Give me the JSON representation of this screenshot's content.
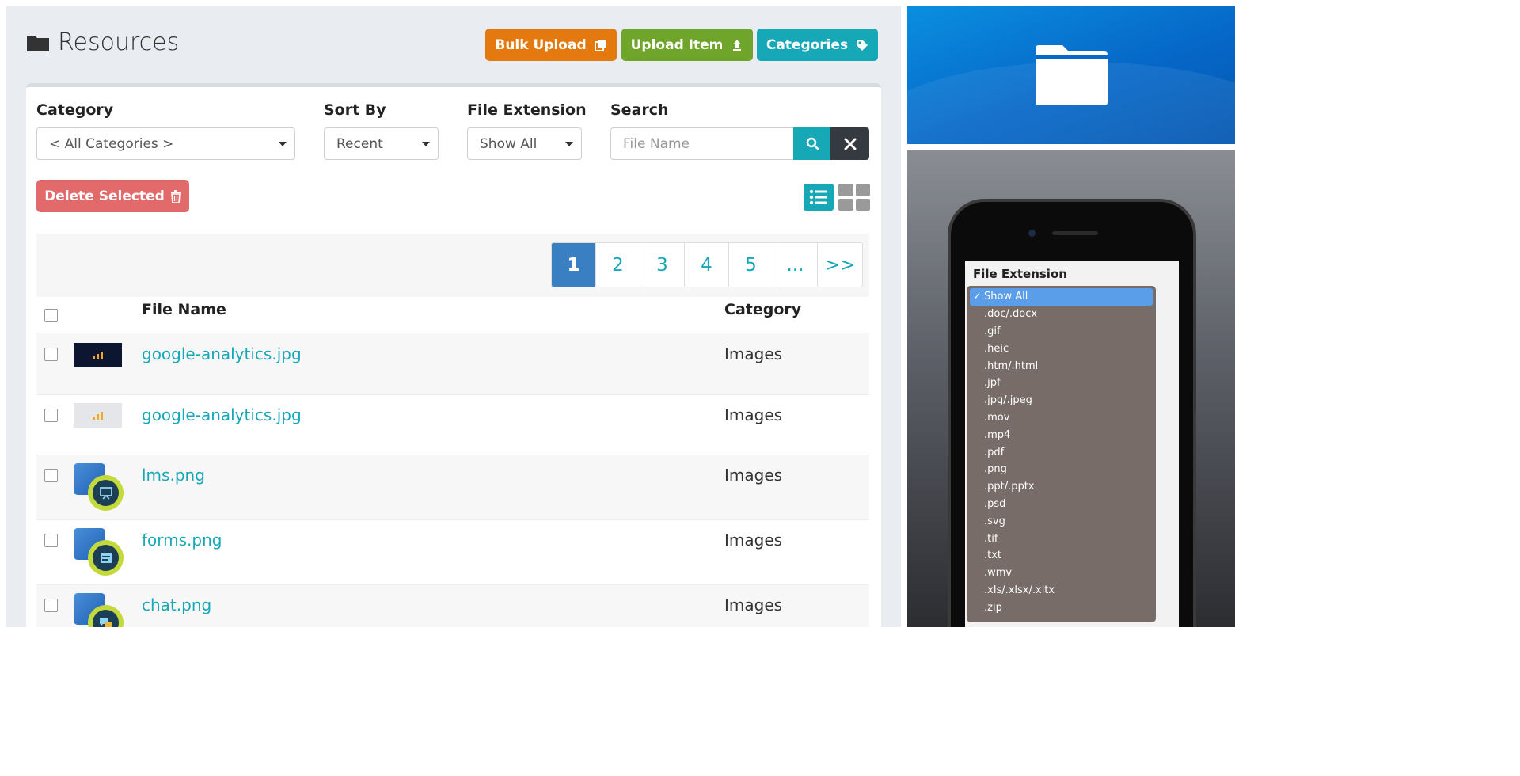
{
  "page": {
    "title": "Resources",
    "buttons": {
      "bulk_upload": "Bulk Upload",
      "upload_item": "Upload Item",
      "categories": "Categories"
    }
  },
  "filters": {
    "category_label": "Category",
    "category_value": "< All Categories >",
    "sort_label": "Sort By",
    "sort_value": "Recent",
    "extension_label": "File Extension",
    "extension_value": "Show All",
    "search_label": "Search",
    "search_placeholder": "File Name"
  },
  "actions": {
    "delete_selected": "Delete Selected"
  },
  "pagination": [
    "1",
    "2",
    "3",
    "4",
    "5",
    "...",
    ">>"
  ],
  "table": {
    "headers": {
      "file_name": "File Name",
      "category": "Category"
    },
    "rows": [
      {
        "name": "google-analytics.jpg",
        "category": "Images"
      },
      {
        "name": "google-analytics.jpg",
        "category": "Images"
      },
      {
        "name": "lms.png",
        "category": "Images"
      },
      {
        "name": "forms.png",
        "category": "Images"
      },
      {
        "name": "chat.png",
        "category": "Images"
      }
    ]
  },
  "mobile": {
    "label": "File Extension",
    "options": [
      ".doc/.docx",
      ".gif",
      ".heic",
      ".htm/.html",
      ".jpf",
      ".jpg/.jpeg",
      ".mov",
      ".mp4",
      ".pdf",
      ".png",
      ".ppt/.pptx",
      ".psd",
      ".svg",
      ".tif",
      ".txt",
      ".wmv",
      ".xls/.xlsx/.xltx",
      ".zip"
    ],
    "selected": "Show All"
  },
  "colors": {
    "accent": "#17a8b8",
    "bulk": "#e3790f",
    "upload": "#6fa52b",
    "delete": "#e26a6a",
    "active_page": "#3a7fc2"
  }
}
